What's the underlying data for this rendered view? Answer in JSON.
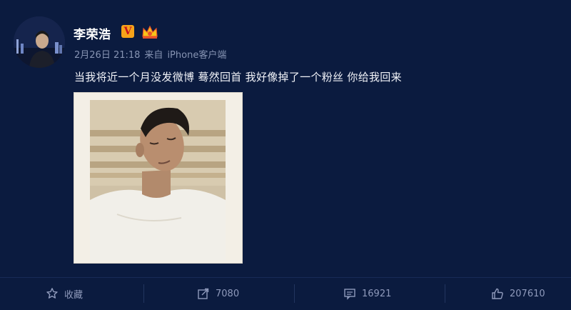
{
  "post": {
    "author": "李荣浩",
    "badge_v": "V",
    "time": "2月26日 21:18",
    "source_prefix": "来自",
    "source": "iPhone客户端",
    "text": "当我将近一个月没发微博  蓦然回首  我好像掉了一个粉丝  你给我回来"
  },
  "actions": {
    "favorite_label": "收藏",
    "repost_count": "7080",
    "comment_count": "16921",
    "like_count": "207610"
  },
  "icons": {
    "avatar": "user-avatar",
    "verified": "verified-v-icon",
    "vip": "crown-icon",
    "favorite": "star-icon",
    "repost": "edit-share-icon",
    "comment": "comment-icon",
    "like": "thumbs-up-icon"
  },
  "colors": {
    "background": "#0b1b3f",
    "text": "#f1f3f8",
    "meta": "#8794b3",
    "verified": "#f6a319"
  }
}
